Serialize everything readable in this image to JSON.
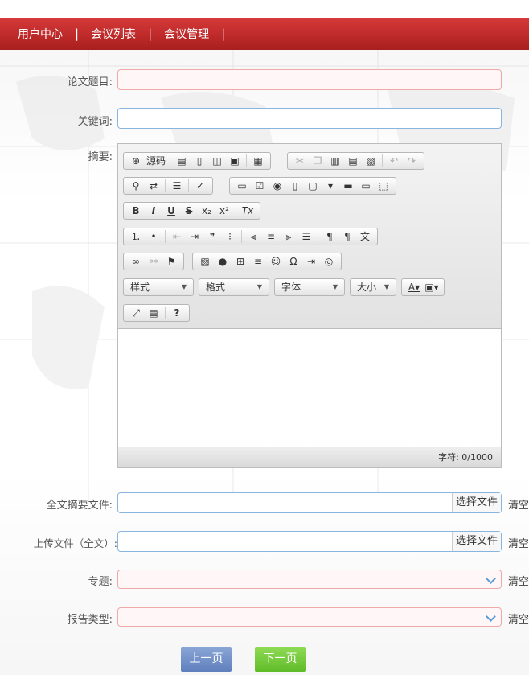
{
  "nav": {
    "items": [
      "用户中心",
      "会议列表",
      "会议管理"
    ],
    "separator": "|"
  },
  "form": {
    "title_label": "论文题目:",
    "title_value": "",
    "keywords_label": "关键词:",
    "keywords_value": "",
    "abstract_label": "摘要:",
    "summary_file_label": "全文摘要文件:",
    "summary_file_button": "选择文件",
    "summary_file_clear": "清空",
    "upload_label": "上传文件（全文）:",
    "upload_button": "选择文件",
    "upload_clear": "清空",
    "topic_label": "专题:",
    "topic_clear": "清空",
    "report_type_label": "报告类型:",
    "report_type_clear": "清空"
  },
  "editor": {
    "source_label": "源码",
    "combos": [
      "样式",
      "格式",
      "字体",
      "大小"
    ],
    "char_count": "字符: 0/1000"
  },
  "buttons": {
    "prev": "上一页",
    "next": "下一页"
  },
  "colors": {
    "nav_red": "#c12e2e",
    "prev_blue": "#6f8fc9",
    "next_green": "#74c93a",
    "error_border": "#f0a8a8",
    "field_border": "#88b4e0"
  }
}
